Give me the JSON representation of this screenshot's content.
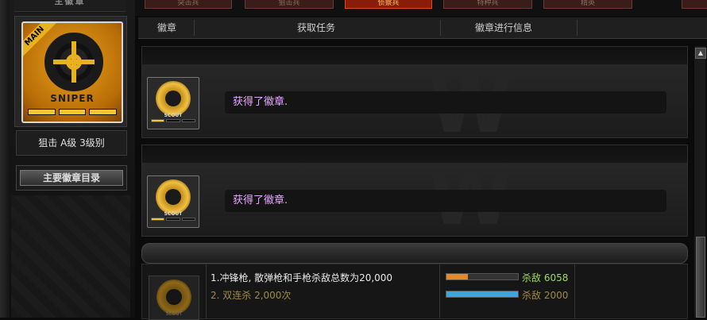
{
  "left_panel": {
    "title": "主徽章",
    "badge": {
      "ribbon": "MAIN",
      "name": "SNIPER"
    },
    "level_text": "狙击 A级 3级别",
    "main_list_button": "主要徽章目录"
  },
  "tabs": [
    {
      "label": "突击兵",
      "active": false
    },
    {
      "label": "狙击兵",
      "active": false
    },
    {
      "label": "侦察兵",
      "active": true
    },
    {
      "label": "特种兵",
      "active": false
    },
    {
      "label": "精英",
      "active": false
    }
  ],
  "table_header": {
    "col1": "徽章",
    "col2": "获取任务",
    "col3": "徽章进行信息"
  },
  "badge_entries": [
    {
      "badge_name": "SCOUT",
      "message": "获得了徽章."
    },
    {
      "badge_name": "SCOUT",
      "message": "获得了徽章."
    }
  ],
  "mission": {
    "badge_name": "SCOUT",
    "task1": "1.冲锋枪, 散弹枪和手枪杀敌总数为20,000",
    "task2": "2. 双连杀 2,000次",
    "progress1": {
      "label": "杀敌",
      "value": "6058",
      "fraction": 0.3,
      "color": "#e08a2a",
      "text_color": "#9fd860"
    },
    "progress2": {
      "label": "杀敌",
      "value": "2000",
      "fraction": 1.0,
      "color": "#3aa8e0",
      "text_color": "#a08a45"
    }
  },
  "scroll_up_glyph": "▲",
  "watermark": "W"
}
